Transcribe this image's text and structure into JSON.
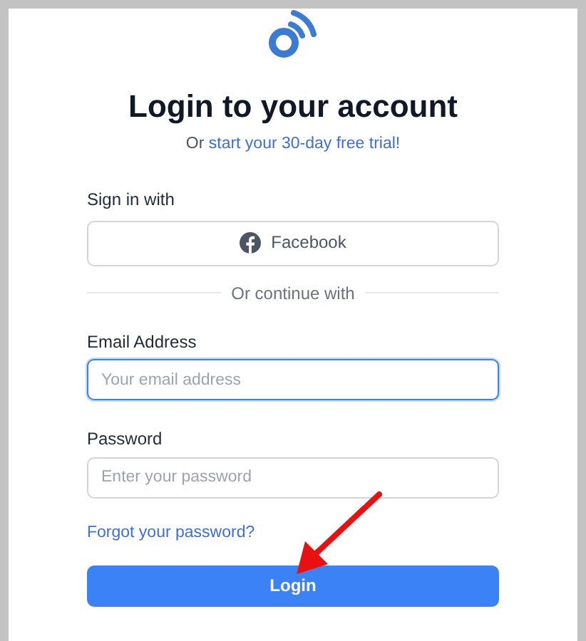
{
  "heading": {
    "title": "Login to your account",
    "prefix": "Or",
    "trial_link": "start your 30-day free trial!"
  },
  "social": {
    "label": "Sign in with",
    "buttons": [
      {
        "label": "Facebook",
        "kind": "facebook"
      }
    ]
  },
  "divider": "Or continue with",
  "fields": [
    {
      "label": "Email Address",
      "placeholder": "Your email address",
      "focused": true
    },
    {
      "label": "Password",
      "placeholder": "Enter your password",
      "focused": false
    }
  ],
  "forgot_link": "Forgot your password?",
  "submit": "Login",
  "annotation": {
    "kind": "arrow"
  }
}
